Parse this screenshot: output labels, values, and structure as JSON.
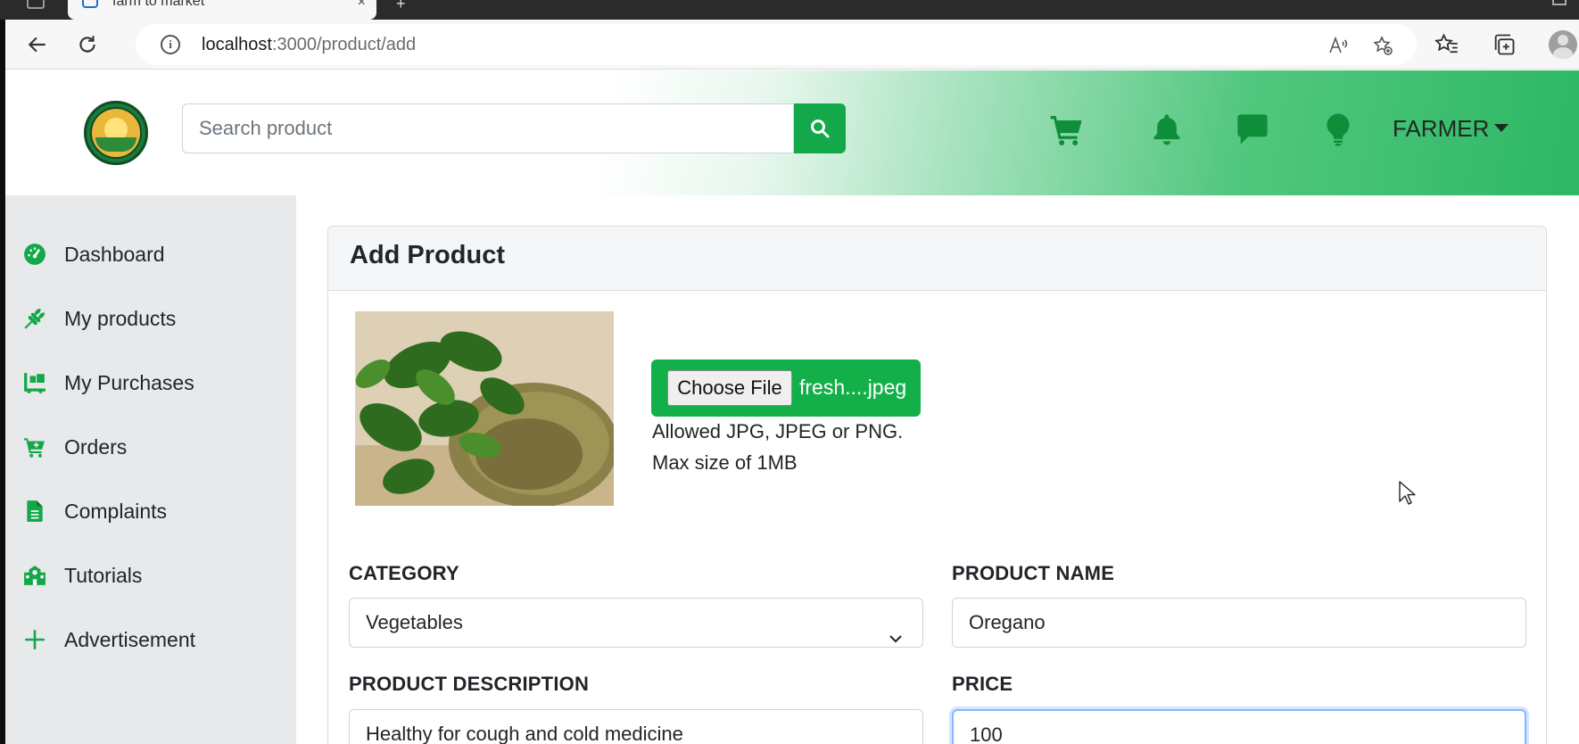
{
  "browser": {
    "tab_title": "farm to market",
    "tab_close": "×",
    "new_tab": "+",
    "url_host": "localhost",
    "url_rest": ":3000/product/add",
    "info_glyph": "i"
  },
  "header": {
    "search_placeholder": "Search product",
    "user_menu_label": "FARMER",
    "icons": [
      "cart-icon",
      "bell-icon",
      "chat-icon",
      "lightbulb-icon"
    ]
  },
  "sidebar": {
    "items": [
      {
        "label": "Dashboard",
        "icon": "dashboard-gauge-icon"
      },
      {
        "label": "My products",
        "icon": "wheat-icon"
      },
      {
        "label": "My Purchases",
        "icon": "truck-loading-icon"
      },
      {
        "label": "Orders",
        "icon": "cart-plus-icon"
      },
      {
        "label": "Complaints",
        "icon": "file-icon"
      },
      {
        "label": "Tutorials",
        "icon": "school-icon"
      },
      {
        "label": "Advertisement",
        "icon": "plus-icon"
      }
    ]
  },
  "form": {
    "title": "Add Product",
    "file_button": "Choose File",
    "file_name": "fresh....jpeg",
    "hint_line1": "Allowed JPG, JPEG or PNG.",
    "hint_line2": "Max size of 1MB",
    "category_label": "CATEGORY",
    "category_value": "Vegetables",
    "product_name_label": "PRODUCT NAME",
    "product_name_value": "Oregano",
    "description_label": "PRODUCT DESCRIPTION",
    "description_value": "Healthy for cough and cold medicine",
    "price_label": "PRICE",
    "price_value": "100"
  },
  "colors": {
    "brand_green": "#13a84a",
    "icon_green": "#0f8e3a",
    "sidebar_bg": "#e8e9eb",
    "focus_ring": "#86b7fe"
  }
}
